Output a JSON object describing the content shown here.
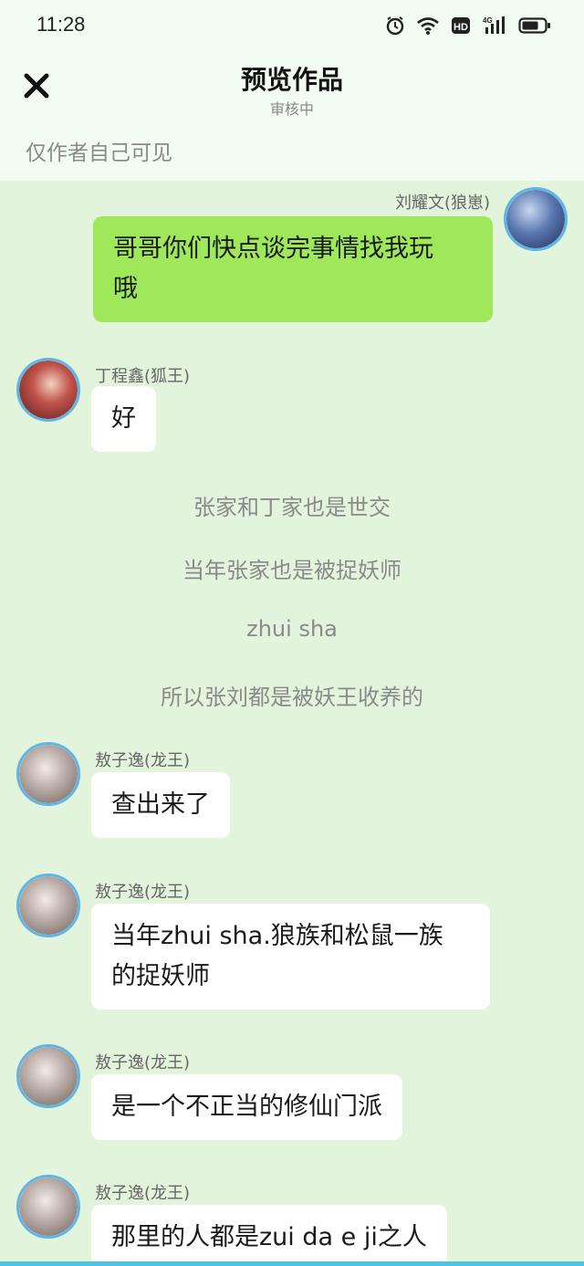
{
  "status_bar": {
    "time": "11:28",
    "icons": [
      "alarm-icon",
      "wifi-icon",
      "hd-icon",
      "4g-signal-icon",
      "battery-icon"
    ]
  },
  "header": {
    "title": "预览作品",
    "subtitle": "审核中",
    "close_icon": "close-icon"
  },
  "visibility_note": "仅作者自己可见",
  "colors": {
    "page_bg": "#f3fcf2",
    "chat_bg": "#e3f4dc",
    "green_bubble": "#9fe85a",
    "avatar_border": "#5fb6e6"
  },
  "messages": [
    {
      "type": "right",
      "name": "刘耀文(狼崽)",
      "lines": [
        "哥哥你们快点谈完事情找我玩",
        "哦"
      ]
    },
    {
      "type": "left",
      "name": "丁程鑫(狐王)",
      "lines": [
        "好"
      ]
    },
    {
      "type": "narration",
      "text": "张家和丁家也是世交"
    },
    {
      "type": "narration",
      "text": "当年张家也是被捉妖师"
    },
    {
      "type": "narration",
      "text": "zhui sha"
    },
    {
      "type": "narration",
      "text": "所以张刘都是被妖王收养的"
    },
    {
      "type": "left",
      "name": "敖子逸(龙王)",
      "lines": [
        "查出来了"
      ]
    },
    {
      "type": "left",
      "name": "敖子逸(龙王)",
      "lines": [
        "当年zhui sha.狼族和松鼠一族",
        "的捉妖师"
      ]
    },
    {
      "type": "left",
      "name": "敖子逸(龙王)",
      "lines": [
        "是一个不正当的修仙门派"
      ]
    },
    {
      "type": "left",
      "name": "敖子逸(龙王)",
      "lines": [
        "那里的人都是zui da e ji之人"
      ]
    }
  ]
}
